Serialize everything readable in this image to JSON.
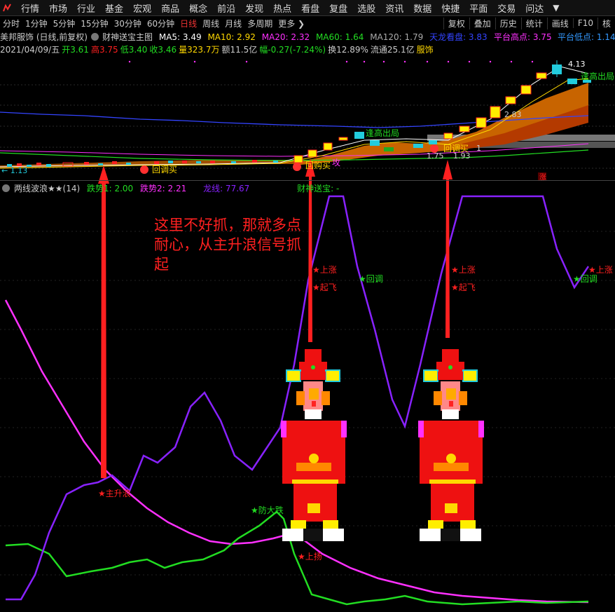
{
  "menu": [
    "行情",
    "市场",
    "行业",
    "基金",
    "宏观",
    "商品",
    "概念",
    "前沿",
    "发现",
    "热点",
    "看盘",
    "复盘",
    "选股",
    "资讯",
    "数据",
    "快捷",
    "平面",
    "交易",
    "问达"
  ],
  "periods": [
    {
      "label": "分时",
      "active": false
    },
    {
      "label": "1分钟",
      "active": false
    },
    {
      "label": "5分钟",
      "active": false
    },
    {
      "label": "15分钟",
      "active": false
    },
    {
      "label": "30分钟",
      "active": false
    },
    {
      "label": "60分钟",
      "active": false
    },
    {
      "label": "日线",
      "active": true
    },
    {
      "label": "周线",
      "active": false
    },
    {
      "label": "月线",
      "active": false
    },
    {
      "label": "多周期",
      "active": false
    },
    {
      "label": "更多 ❯",
      "active": false
    }
  ],
  "right_tools": [
    "复权",
    "叠加",
    "历史",
    "统计",
    "画线",
    "F10",
    "核"
  ],
  "stock": {
    "name": "美邦服饰 (日线,前复权)",
    "indicator": "财神送宝主图",
    "ma5": "MA5: 3.49",
    "ma10": "MA10: 2.92",
    "ma20": "MA20: 2.32",
    "ma60": "MA60: 1.64",
    "ma120": "MA120: 1.79",
    "tianlong": "天龙看盘: 3.83",
    "pt_high": "平台高点: 3.75",
    "pt_low": "平台低点: 1.14"
  },
  "ohlc": {
    "date": "2021/04/09/五",
    "open": "开3.61",
    "high": "高3.75",
    "low": "低3.40",
    "close": "收3.46",
    "vol": "量323.7万",
    "amt": "额11.5亿",
    "chg": "幅-0.27(-7.24%)",
    "turn": "换12.89%",
    "float": "流通25.1亿",
    "sector": "服饰"
  },
  "indicator2": {
    "name": "两线波浪★★(14)",
    "fall1": "跌势1: 2.00",
    "fall2": "跌势2: 2.21",
    "dragon": "龙线: 77.67",
    "caishen": "财神送宝: -"
  },
  "price_labels": {
    "low": "← 1.13",
    "high": "4.13",
    "p283": "2.83",
    "p175": "1.75",
    "p193": "1.93",
    "p1": "1"
  },
  "signals_main": {
    "huitiao1": "回调买",
    "huigou": "回购买",
    "gong": "攻",
    "fengao1": "逢高出局",
    "huitiao2": "回调买",
    "fengao2": "逢高出局",
    "zhang": "涨"
  },
  "signals_sub": {
    "zhushenglang": "★主升浪",
    "fangdadie": "★防大跌",
    "shangyang": "★上扬",
    "shangzhang1": "★上涨",
    "qifei1": "★起飞",
    "huitiao1": "★回调",
    "shangzhang2": "★上涨",
    "qifei2": "★起飞",
    "huitiao2": "★回调",
    "shangzhang3": "★上涨"
  },
  "annotation": "这里不好抓，那就多点耐心，从主升浪信号抓起",
  "colors": {
    "up": "#ff2020",
    "down": "#22ccdd",
    "ma5": "#ffffff",
    "ma10": "#ffd800",
    "ma20": "#ff30ff",
    "ma60": "#22dd22",
    "ma120": "#999999",
    "dragon": "#8822ff"
  }
}
